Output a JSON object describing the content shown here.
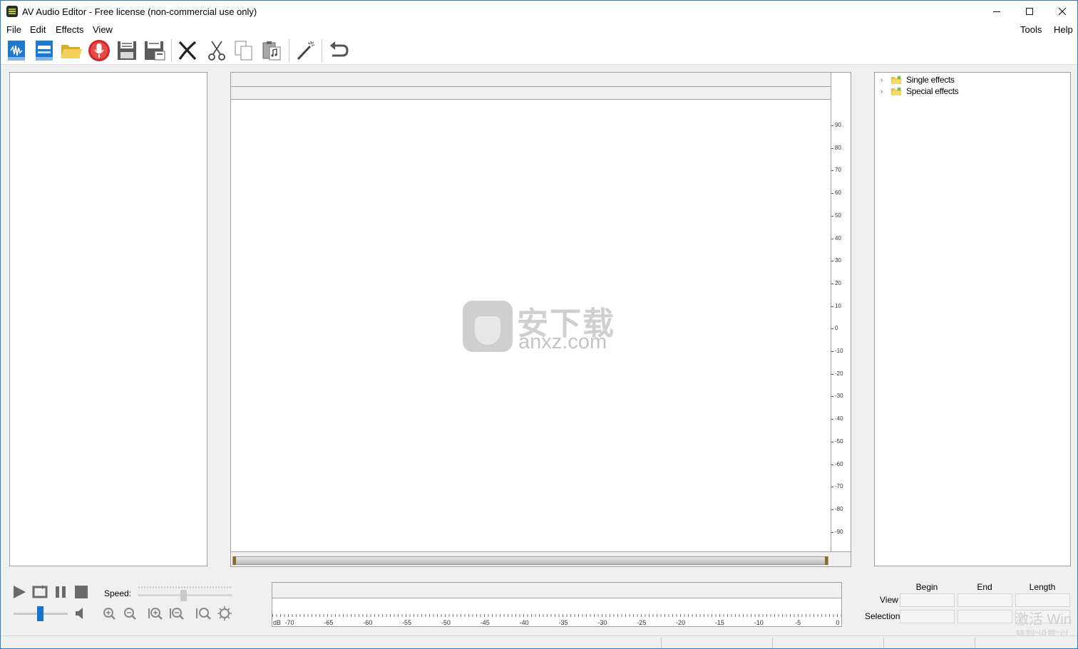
{
  "window": {
    "title": "AV Audio Editor - Free license (non-commercial use only)"
  },
  "menu": {
    "file": "File",
    "edit": "Edit",
    "effects": "Effects",
    "view": "View",
    "tools": "Tools",
    "help": "Help"
  },
  "toolbar": {
    "icons": [
      "new-wave-icon",
      "new-file-icon",
      "open-folder-icon",
      "record-icon",
      "save-icon",
      "save-as-icon",
      "delete-icon",
      "cut-icon",
      "copy-icon",
      "paste-icon",
      "magic-wand-icon",
      "undo-icon"
    ]
  },
  "editor": {
    "close_glyph": "✖",
    "db_scale": [
      "90",
      "80",
      "70",
      "60",
      "50",
      "40",
      "30",
      "20",
      "10",
      "0",
      "-10",
      "-20",
      "-30",
      "-40",
      "-50",
      "-60",
      "-70",
      "-80",
      "-90"
    ]
  },
  "effects_tree": {
    "items": [
      {
        "label": "Single effects"
      },
      {
        "label": "Special effects"
      }
    ]
  },
  "watermark": {
    "cn": "安下载",
    "en": "anxz.com"
  },
  "playback": {
    "speed_label": "Speed:",
    "speed_level": 0.48,
    "volume_level": 0.49
  },
  "level_meter": {
    "unit": "dB",
    "labels": [
      "-70",
      "-65",
      "-60",
      "-55",
      "-50",
      "-45",
      "-40",
      "-35",
      "-30",
      "-25",
      "-20",
      "-15",
      "-10",
      "-5",
      "0"
    ]
  },
  "selection": {
    "headers": {
      "begin": "Begin",
      "end": "End",
      "length": "Length"
    },
    "rows": {
      "view": "View",
      "selection": "Selection"
    }
  },
  "os_overlay": {
    "activate_line1": "激活 Win",
    "activate_line2": "转到\"设置\"以"
  },
  "colors": {
    "accent_blue": "#1673d2",
    "record_red": "#d32626",
    "folder_yellow": "#f2c94c"
  }
}
